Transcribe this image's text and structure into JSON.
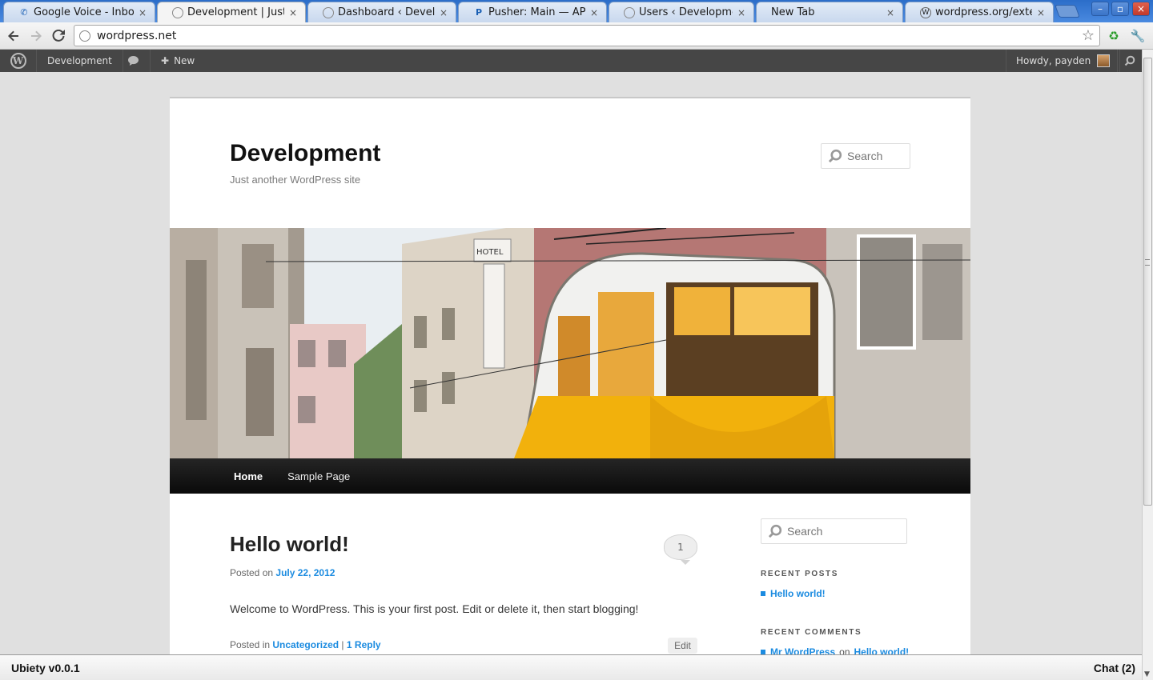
{
  "browser": {
    "tabs": [
      {
        "label": "Google Voice - Inbox",
        "icon": "phone-icon",
        "active": false
      },
      {
        "label": "Development | Just another WordPress site",
        "icon": "globe-icon",
        "active": true
      },
      {
        "label": "Dashboard ‹ Development — WordPress",
        "icon": "globe-icon",
        "active": false
      },
      {
        "label": "Pusher: Main — API Access",
        "icon": "pusher-icon",
        "active": false
      },
      {
        "label": "Users ‹ Development — WordPress",
        "icon": "globe-icon",
        "active": false
      },
      {
        "label": "New Tab",
        "icon": "",
        "active": false
      },
      {
        "label": "wordpress.org/extend/plugins",
        "icon": "wordpress-icon",
        "active": false
      }
    ],
    "tab_close_glyph": "×",
    "url": "wordpress.net",
    "window_controls": {
      "minimize": "–",
      "restore": "▫",
      "close": "×"
    }
  },
  "adminbar": {
    "site_name": "Development",
    "new_label": "New",
    "howdy": "Howdy, payden"
  },
  "site": {
    "title": "Development",
    "description": "Just another WordPress site",
    "search_placeholder": "Search"
  },
  "nav": {
    "items": [
      {
        "label": "Home",
        "current": true
      },
      {
        "label": "Sample Page",
        "current": false
      }
    ]
  },
  "post": {
    "title": "Hello world!",
    "comment_count": "1",
    "posted_on_prefix": "Posted on",
    "date": "July 22, 2012",
    "content": "Welcome to WordPress. This is your first post. Edit or delete it, then start blogging!",
    "posted_in_prefix": "Posted in",
    "category": "Uncategorized",
    "separator": "|",
    "replies": "1 Reply",
    "edit_label": "Edit"
  },
  "sidebar": {
    "search_placeholder": "Search",
    "recent_posts_title": "RECENT POSTS",
    "recent_posts": [
      "Hello world!"
    ],
    "recent_comments_title": "RECENT COMMENTS",
    "recent_comment": {
      "author": "Mr WordPress",
      "on": "on",
      "post": "Hello world!"
    }
  },
  "chatbar": {
    "app_name": "Ubiety v0.0.1",
    "chat_label": "Chat (2)"
  },
  "colors": {
    "tabstrip": "#2b6dc9",
    "adminbar": "#464646",
    "link": "#1b8be0",
    "nav_bg": "#111111",
    "tram_yellow": "#f2b10c"
  }
}
